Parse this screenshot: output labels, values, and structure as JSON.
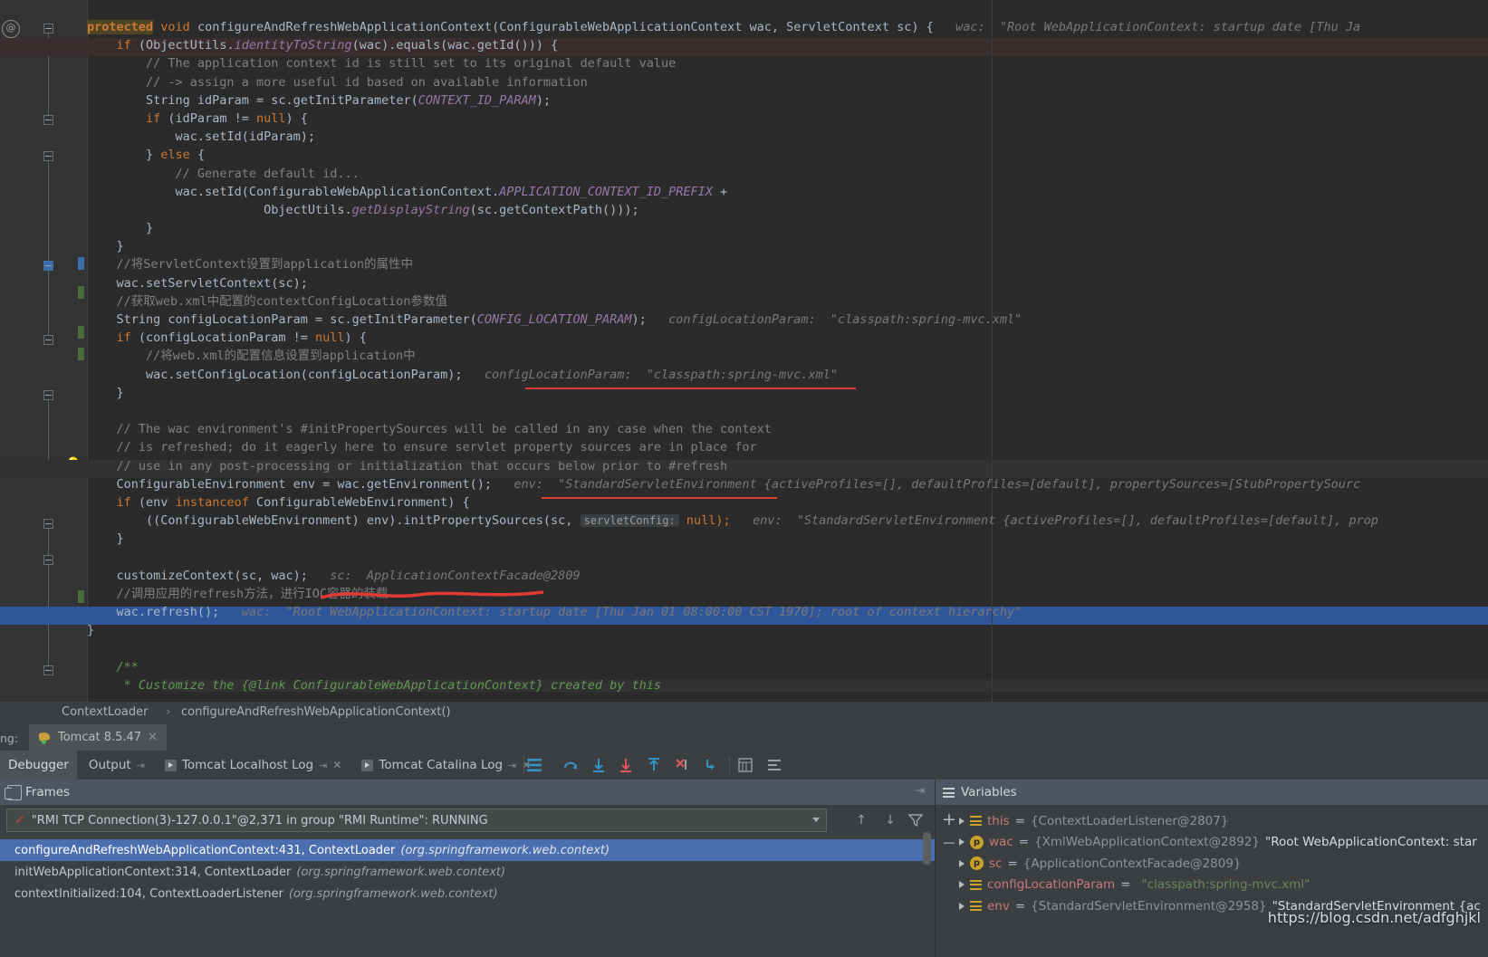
{
  "editor": {
    "code_lines": [
      {
        "indent": 0,
        "segments": [
          {
            "t": "protected",
            "c": "kws",
            "sel": true
          },
          {
            "t": " ",
            "c": ""
          },
          {
            "t": "void",
            "c": "kw"
          },
          {
            "t": " ",
            "c": ""
          },
          {
            "t": "configureAndRefreshWebApplicationContext",
            "c": ""
          },
          {
            "t": "(ConfigurableWebApplicationContext wac, ServletContext sc) {",
            "c": ""
          }
        ],
        "hint": "wac:  \"Root WebApplicationContext: startup date [Thu Ja"
      },
      {
        "indent": 1,
        "segments": [
          {
            "t": "if",
            "c": "kw"
          },
          {
            "t": " (ObjectUtils.",
            "c": ""
          },
          {
            "t": "identityToString",
            "c": "fld"
          },
          {
            "t": "(wac).equals(wac.getId())) {",
            "c": ""
          }
        ],
        "hint": ""
      },
      {
        "indent": 2,
        "segments": [
          {
            "t": "// The application context id is still set to its original default value",
            "c": "cm"
          }
        ],
        "hint": ""
      },
      {
        "indent": 2,
        "segments": [
          {
            "t": "// -> assign a more useful id based on available information",
            "c": "cm"
          }
        ],
        "hint": ""
      },
      {
        "indent": 2,
        "segments": [
          {
            "t": "String idParam = sc.getInitParameter(",
            "c": ""
          },
          {
            "t": "CONTEXT_ID_PARAM",
            "c": "sfld"
          },
          {
            "t": ");",
            "c": ""
          }
        ],
        "hint": ""
      },
      {
        "indent": 2,
        "segments": [
          {
            "t": "if",
            "c": "kw"
          },
          {
            "t": " (idParam != ",
            "c": ""
          },
          {
            "t": "null",
            "c": "kw"
          },
          {
            "t": ") {",
            "c": ""
          }
        ],
        "hint": ""
      },
      {
        "indent": 3,
        "segments": [
          {
            "t": "wac.setId(idParam);",
            "c": ""
          }
        ],
        "hint": ""
      },
      {
        "indent": 2,
        "segments": [
          {
            "t": "} ",
            "c": ""
          },
          {
            "t": "else",
            "c": "kw"
          },
          {
            "t": " {",
            "c": ""
          }
        ],
        "hint": ""
      },
      {
        "indent": 3,
        "segments": [
          {
            "t": "// Generate default id...",
            "c": "cm"
          }
        ],
        "hint": ""
      },
      {
        "indent": 3,
        "segments": [
          {
            "t": "wac.setId(ConfigurableWebApplicationContext.",
            "c": ""
          },
          {
            "t": "APPLICATION_CONTEXT_ID_PREFIX",
            "c": "sfld"
          },
          {
            "t": " +",
            "c": ""
          }
        ],
        "hint": ""
      },
      {
        "indent": 6,
        "segments": [
          {
            "t": "ObjectUtils.",
            "c": ""
          },
          {
            "t": "getDisplayString",
            "c": "fld"
          },
          {
            "t": "(sc.getContextPath()));",
            "c": ""
          }
        ],
        "hint": ""
      },
      {
        "indent": 2,
        "segments": [
          {
            "t": "}",
            "c": ""
          }
        ],
        "hint": ""
      },
      {
        "indent": 1,
        "segments": [
          {
            "t": "}",
            "c": ""
          }
        ],
        "hint": ""
      },
      {
        "indent": 1,
        "segments": [
          {
            "t": "//将ServletContext设置到application的属性中",
            "c": "cm"
          }
        ],
        "hint": ""
      },
      {
        "indent": 1,
        "segments": [
          {
            "t": "wac.setServletContext(sc);",
            "c": ""
          }
        ],
        "hint": ""
      },
      {
        "indent": 1,
        "segments": [
          {
            "t": "//获取web.xml中配置的contextConfigLocation参数值",
            "c": "cm"
          }
        ],
        "hint": ""
      },
      {
        "indent": 1,
        "segments": [
          {
            "t": "String configLocationParam = sc.getInitParameter(",
            "c": ""
          },
          {
            "t": "CONFIG_LOCATION_PARAM",
            "c": "sfld"
          },
          {
            "t": ");",
            "c": ""
          }
        ],
        "hint": "configLocationParam:  \"classpath:spring-mvc.xml\""
      },
      {
        "indent": 1,
        "segments": [
          {
            "t": "if",
            "c": "kw"
          },
          {
            "t": " (configLocationParam != ",
            "c": ""
          },
          {
            "t": "null",
            "c": "kw"
          },
          {
            "t": ") {",
            "c": ""
          }
        ],
        "hint": ""
      },
      {
        "indent": 2,
        "segments": [
          {
            "t": "//将web.xml的配置信息设置到application中",
            "c": "cm"
          }
        ],
        "hint": ""
      },
      {
        "indent": 2,
        "segments": [
          {
            "t": "wac.setConfigLocation(configLocationParam);",
            "c": ""
          }
        ],
        "hint": "configLocationParam:  \"classpath:spring-mvc.xml\""
      },
      {
        "indent": 1,
        "segments": [
          {
            "t": "}",
            "c": ""
          }
        ],
        "hint": ""
      },
      {
        "indent": 0,
        "segments": [
          {
            "t": "",
            "c": ""
          }
        ],
        "hint": ""
      },
      {
        "indent": 1,
        "segments": [
          {
            "t": "// The wac environment's #initPropertySources will be called in any case when the context",
            "c": "cm"
          }
        ],
        "hint": ""
      },
      {
        "indent": 1,
        "segments": [
          {
            "t": "// is refreshed; do it eagerly here to ensure servlet property sources are in place for",
            "c": "cm"
          }
        ],
        "hint": ""
      },
      {
        "indent": 1,
        "segments": [
          {
            "t": "// use in any post-processing or initialization that occurs below prior to #refresh",
            "c": "cm"
          }
        ],
        "hint": ""
      },
      {
        "indent": 1,
        "segments": [
          {
            "t": "ConfigurableEnvironment env = wac.getEnvironment();",
            "c": ""
          }
        ],
        "hint": "env:  \"StandardServletEnvironment {activeProfiles=[], defaultProfiles=[default], propertySources=[StubPropertySourc"
      },
      {
        "indent": 1,
        "segments": [
          {
            "t": "if",
            "c": "kw"
          },
          {
            "t": " (env ",
            "c": ""
          },
          {
            "t": "instanceof",
            "c": "kw"
          },
          {
            "t": " ConfigurableWebEnvironment) {",
            "c": ""
          }
        ],
        "hint": ""
      },
      {
        "indent": 2,
        "segments": [
          {
            "t": "((ConfigurableWebEnvironment) env).initPropertySources(sc, ",
            "c": ""
          },
          {
            "t": "servletConfig:",
            "c": "chip"
          },
          {
            "t": " null);",
            "c": "kw"
          }
        ],
        "hint": "env:  \"StandardServletEnvironment {activeProfiles=[], defaultProfiles=[default], prop"
      },
      {
        "indent": 1,
        "segments": [
          {
            "t": "}",
            "c": ""
          }
        ],
        "hint": ""
      },
      {
        "indent": 0,
        "segments": [
          {
            "t": "",
            "c": ""
          }
        ],
        "hint": ""
      },
      {
        "indent": 1,
        "segments": [
          {
            "t": "customizeContext(sc, wac);",
            "c": ""
          }
        ],
        "hint": "sc:  ApplicationContextFacade@2809"
      },
      {
        "indent": 1,
        "segments": [
          {
            "t": "//调用应用的refresh方法，进行IOC容器的装载",
            "c": "cm"
          }
        ],
        "hint": ""
      },
      {
        "indent": 1,
        "segments": [
          {
            "t": "wac.refresh();",
            "c": ""
          }
        ],
        "hint": "wac:  \"Root WebApplicationContext: startup date [Thu Jan 01 08:00:00 CST 1970]; root of context hierarchy\""
      },
      {
        "indent": 0,
        "segments": [
          {
            "t": "}",
            "c": ""
          }
        ],
        "hint": ""
      },
      {
        "indent": 0,
        "segments": [
          {
            "t": "",
            "c": ""
          }
        ],
        "hint": ""
      },
      {
        "indent": 1,
        "segments": [
          {
            "t": "/**",
            "c": "cmg"
          }
        ],
        "hint": ""
      },
      {
        "indent": 1,
        "segments": [
          {
            "t": " * Customize the {@link ConfigurableWebApplicationContext} created by this",
            "c": "cmg"
          }
        ],
        "hint": ""
      }
    ]
  },
  "breadcrumb": {
    "class": "ContextLoader",
    "separator": "›",
    "method": "configureAndRefreshWebApplicationContext()"
  },
  "run_tabs": {
    "prefix_label": "ng:",
    "tab_label": "Tomcat 8.5.47",
    "close_glyph": "✕"
  },
  "debug_tabs": [
    {
      "label": "Debugger",
      "active": true,
      "pin": false,
      "play": false,
      "close": false
    },
    {
      "label": "Output",
      "active": false,
      "pin": true,
      "play": false,
      "close": false
    },
    {
      "label": "Tomcat Localhost Log",
      "active": false,
      "pin": true,
      "play": true,
      "close": true
    },
    {
      "label": "Tomcat Catalina Log",
      "active": false,
      "pin": true,
      "play": true,
      "close": true
    }
  ],
  "debug_toolbar_icons": [
    "layout-settings-icon",
    "restore-layout-icon",
    "step-over-icon",
    "step-into-icon",
    "step-out-icon",
    "force-step-into-icon",
    "run-to-cursor-icon",
    "evaluate-expression-icon",
    "settings-icon"
  ],
  "frames": {
    "title": "Frames",
    "thread": {
      "value": "\"RMI TCP Connection(3)-127.0.0.1\"@2,371 in group \"RMI Runtime\": RUNNING",
      "status_glyph": "✓"
    },
    "items": [
      {
        "method": "configureAndRefreshWebApplicationContext:431, ContextLoader",
        "package": "(org.springframework.web.context)",
        "selected": true
      },
      {
        "method": "initWebApplicationContext:314, ContextLoader",
        "package": "(org.springframework.web.context)",
        "selected": false
      },
      {
        "method": "contextInitialized:104, ContextLoaderListener",
        "package": "(org.springframework.web.context)",
        "selected": false
      }
    ]
  },
  "variables": {
    "title": "Variables",
    "pin_glyph": "⇥",
    "items": [
      {
        "icon": "field-icon",
        "name": "this",
        "value": "{ContextLoaderListener@2807}",
        "extra": ""
      },
      {
        "icon": "parameter-icon",
        "name": "wac",
        "value": "{XmlWebApplicationContext@2892}",
        "extra": "\"Root WebApplicationContext: star"
      },
      {
        "icon": "parameter-icon",
        "name": "sc",
        "value": "{ApplicationContextFacade@2809}",
        "extra": ""
      },
      {
        "icon": "field-icon",
        "name": "configLocationParam",
        "value": "=",
        "extra": "\"classpath:spring-mvc.xml\""
      },
      {
        "icon": "field-icon",
        "name": "env",
        "value": "{StandardServletEnvironment@2958}",
        "extra": "\"StandardServletEnvironment {ac"
      }
    ],
    "add_glyph": "+",
    "remove_glyph": "−",
    "filter_glyph": "filter-icon"
  },
  "watermark": {
    "url": "https://blog.csdn.net/adfghjkl"
  },
  "colors": {
    "editor_bg": "#2b2b2b",
    "panel_bg": "#3c3f41",
    "exec_line": "#2f5699",
    "breakpoint_line": "#3a2d2d",
    "selection": "#4b6eaf",
    "annotation_red": "#e03a34",
    "header_blue": "#4c5561"
  }
}
